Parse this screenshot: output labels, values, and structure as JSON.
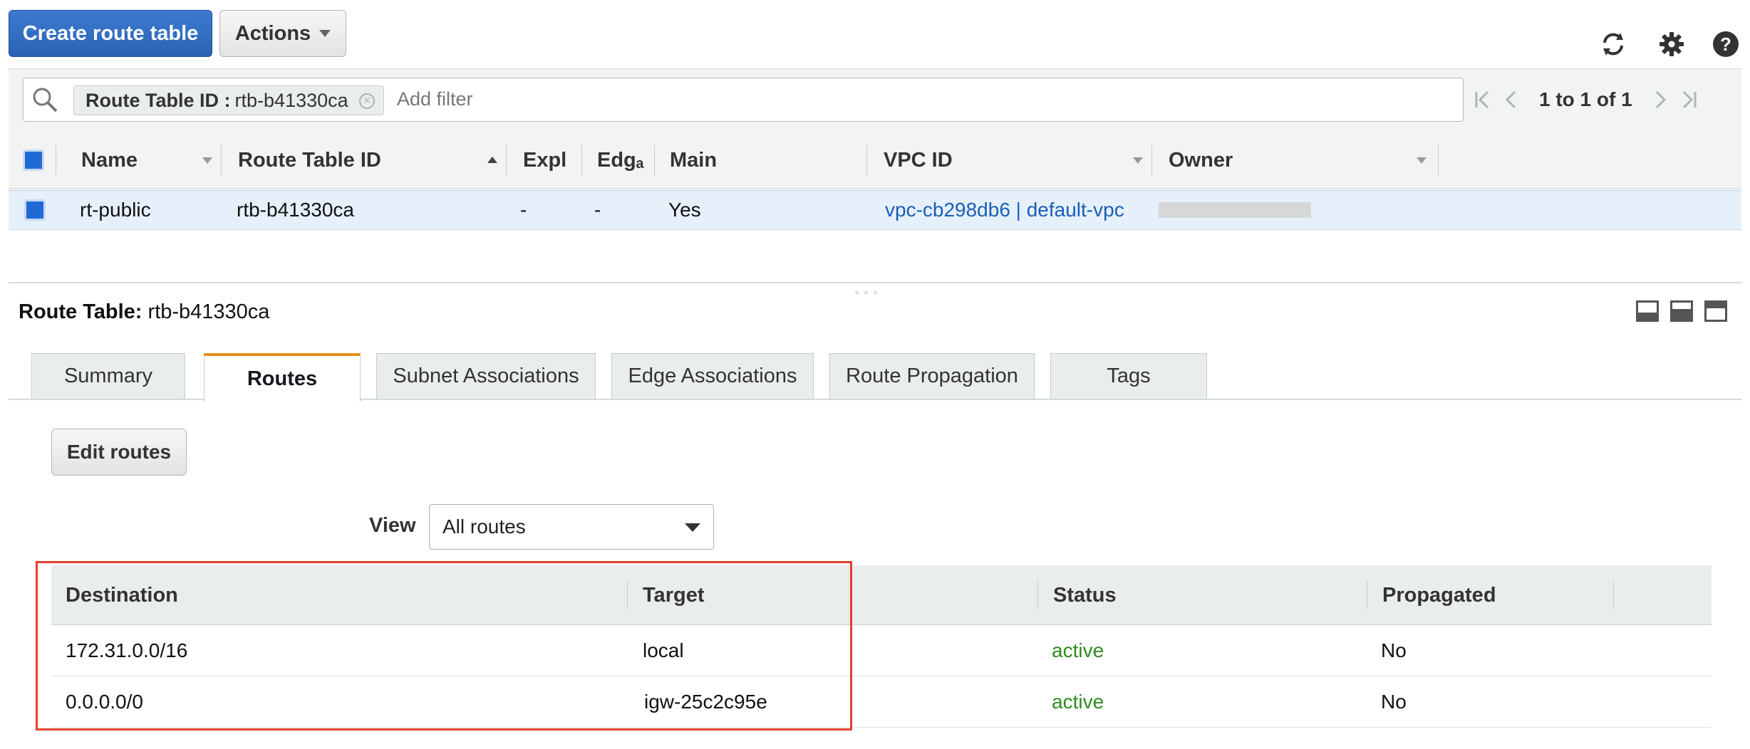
{
  "toolbar": {
    "create_label": "Create route table",
    "actions_label": "Actions"
  },
  "filter": {
    "token_key": "Route Table ID :",
    "token_value": "rtb-b41330ca",
    "placeholder": "Add filter"
  },
  "pager": {
    "count": "1 to 1 of 1"
  },
  "grid": {
    "columns": [
      "Name",
      "Route Table ID",
      "Expl",
      "Edgₐ",
      "Main",
      "VPC ID",
      "Owner"
    ],
    "row": {
      "name": "rt-public",
      "route_table_id": "rtb-b41330ca",
      "explicit": "-",
      "edge": "-",
      "main": "Yes",
      "vpc_id": "vpc-cb298db6 | default-vpc"
    }
  },
  "detail": {
    "title_label": "Route Table:",
    "title_value": "rtb-b41330ca",
    "tabs": [
      "Summary",
      "Routes",
      "Subnet Associations",
      "Edge Associations",
      "Route Propagation",
      "Tags"
    ],
    "active_tab": "Routes",
    "edit_label": "Edit routes",
    "view_label": "View",
    "view_value": "All routes"
  },
  "routes": {
    "columns": [
      "Destination",
      "Target",
      "Status",
      "Propagated"
    ],
    "rows": [
      {
        "destination": "172.31.0.0/16",
        "target": "local",
        "status": "active",
        "propagated": "No"
      },
      {
        "destination": "0.0.0.0/0",
        "target": "igw-25c2c95e",
        "status": "active",
        "propagated": "No"
      }
    ]
  },
  "colors": {
    "primary": "#2a63b5",
    "link": "#1a5fb4",
    "active_status": "#2e8b1e",
    "tab_accent": "#e88a1a",
    "highlight": "#e2402d"
  }
}
